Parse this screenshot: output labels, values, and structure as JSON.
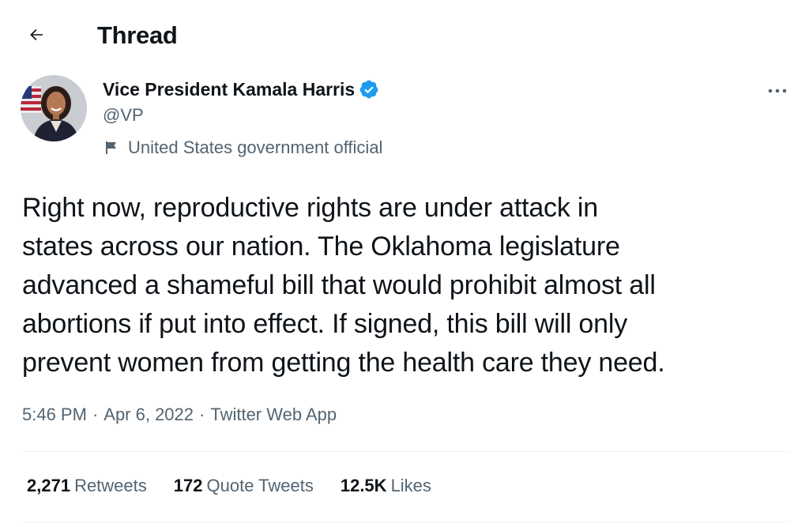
{
  "header": {
    "title": "Thread",
    "back_icon": "arrow-left-icon"
  },
  "tweet": {
    "author": {
      "name": "Vice President Kamala Harris",
      "handle": "@VP",
      "verified_icon": "verified-badge-icon",
      "label": "United States government official",
      "label_icon": "flag-icon",
      "avatar_icon": "avatar-photo"
    },
    "more_icon": "more-horizontal-icon",
    "text": "Right now, reproductive rights are under attack in\nstates across our nation. The Oklahoma legislature\nadvanced a shameful bill that would prohibit almost all\nabortions if put into effect. If signed, this bill will only\nprevent women from getting the health care they need.",
    "time": "5:46 PM",
    "date": "Apr 6, 2022",
    "source": "Twitter Web App",
    "separator": "·",
    "stats": [
      {
        "count": "2,271",
        "label": "Retweets"
      },
      {
        "count": "172",
        "label": "Quote Tweets"
      },
      {
        "count": "12.5K",
        "label": "Likes"
      }
    ]
  },
  "colors": {
    "text_primary": "#0f1419",
    "text_secondary": "#536471",
    "verified_blue": "#1d9bf0",
    "divider": "#eff3f4"
  }
}
